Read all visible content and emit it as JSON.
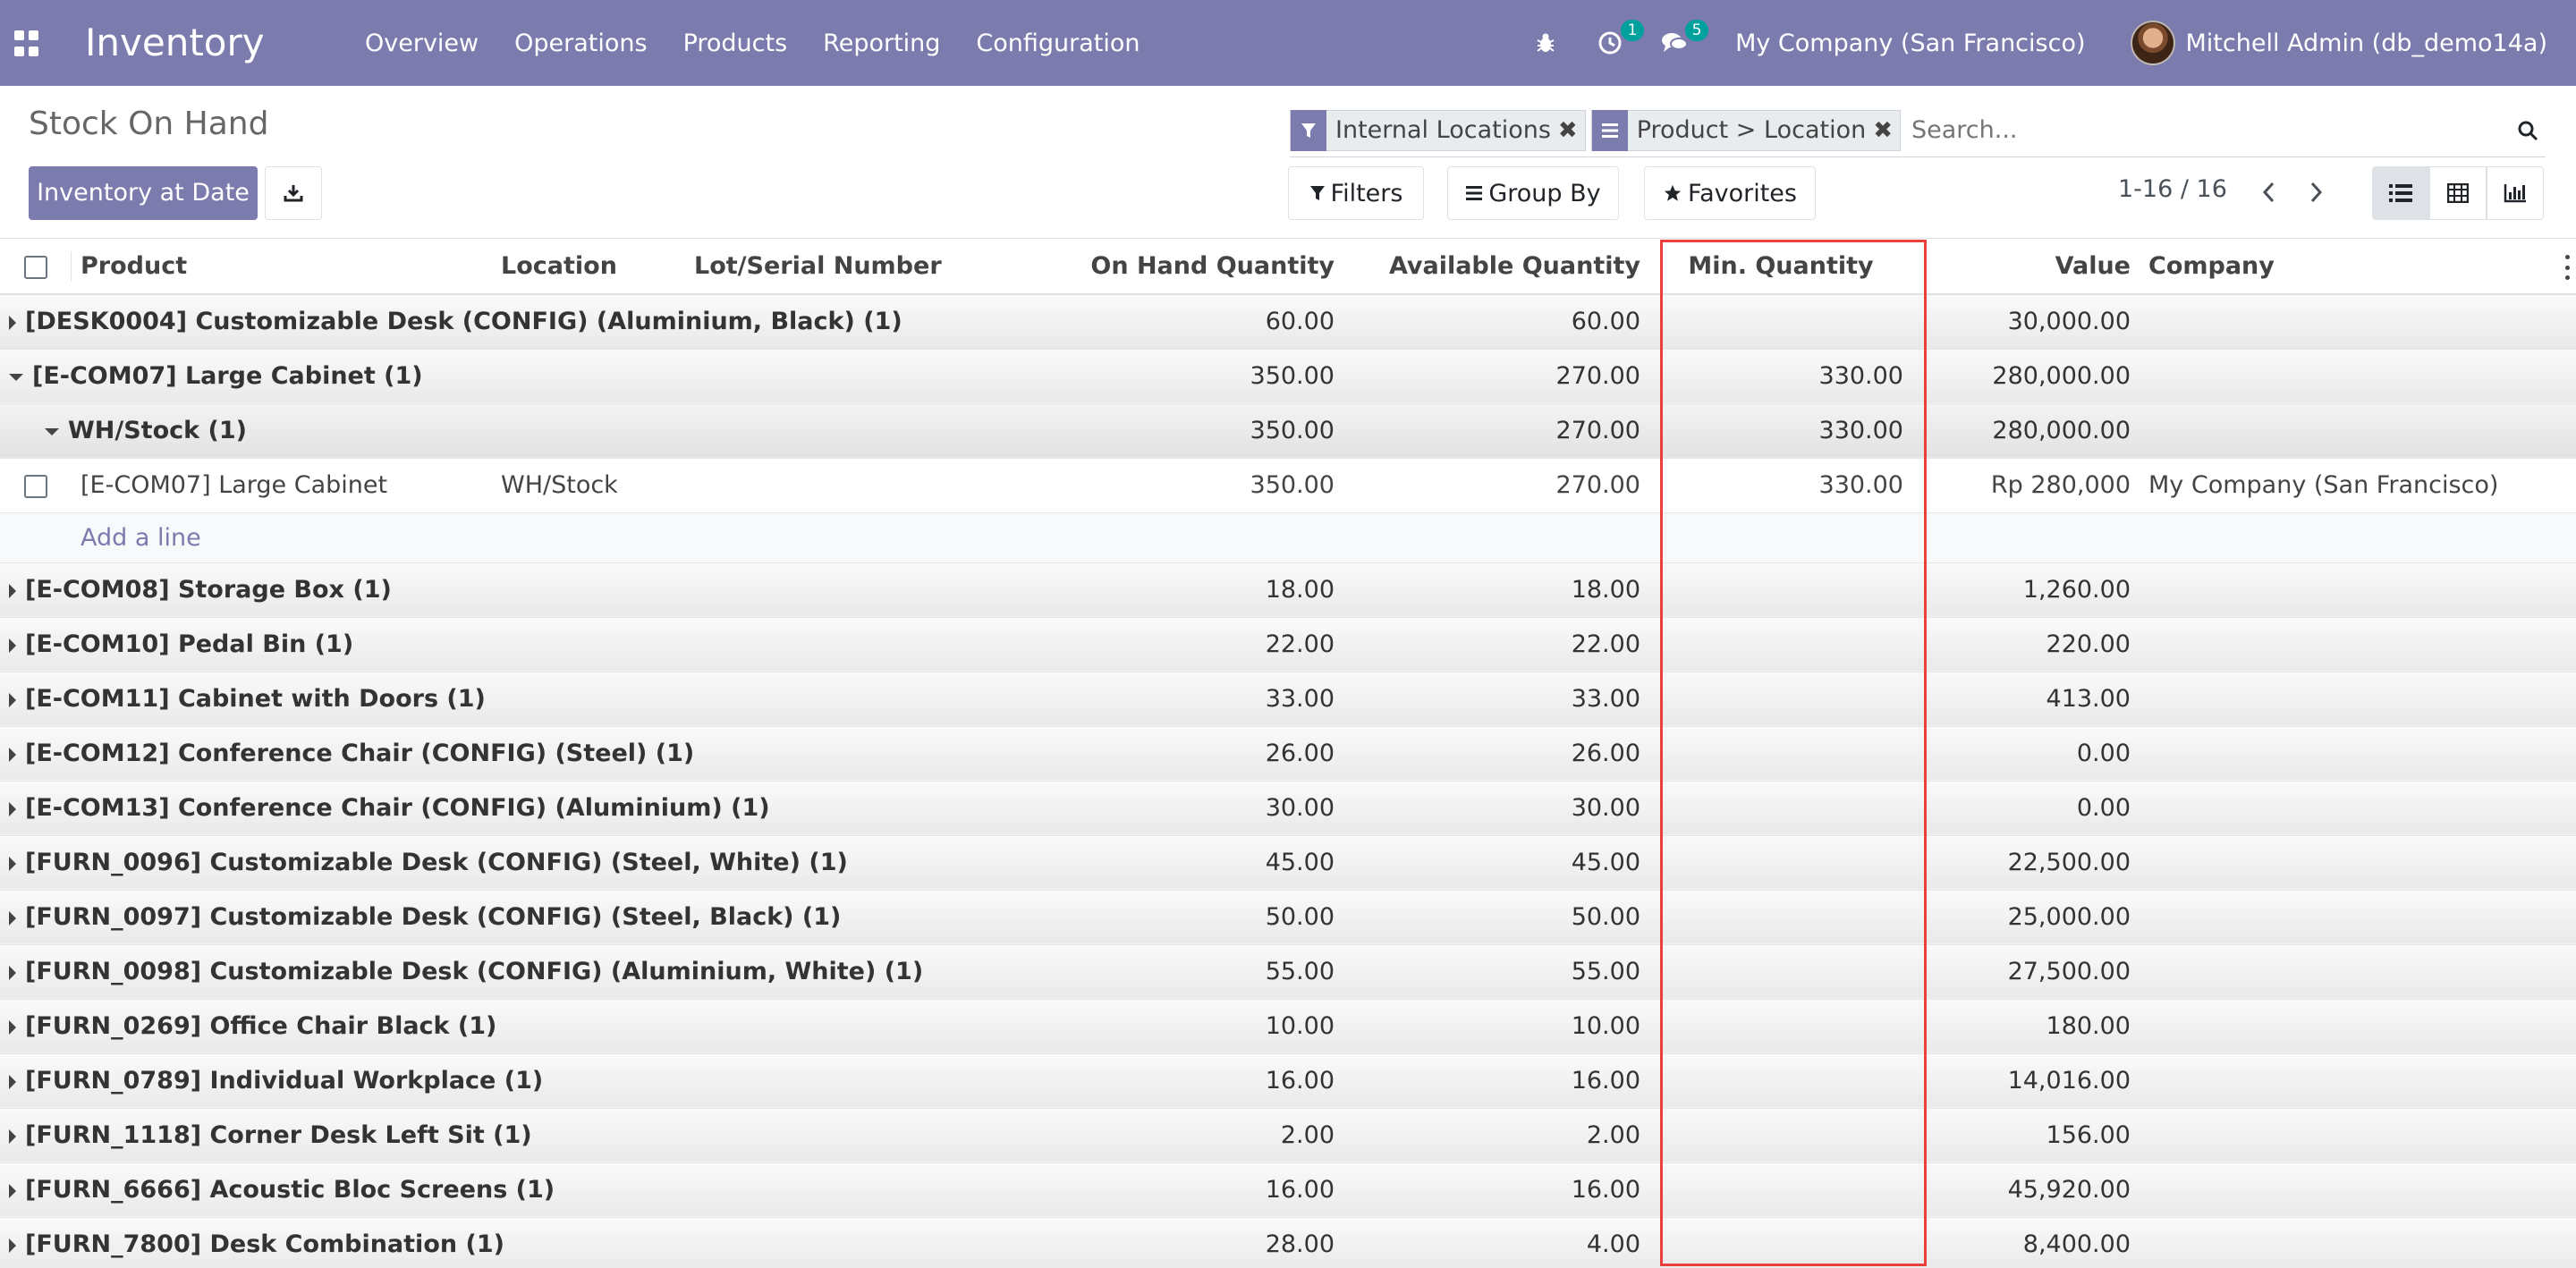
{
  "navbar": {
    "app_name": "Inventory",
    "menu": [
      "Overview",
      "Operations",
      "Products",
      "Reporting",
      "Configuration"
    ],
    "activity_count": "1",
    "messages_count": "5",
    "company": "My Company (San Francisco)",
    "user": "Mitchell Admin (db_demo14a)"
  },
  "control_panel": {
    "title": "Stock On Hand",
    "primary_button": "Inventory at Date",
    "facets": [
      {
        "icon": "filter-icon",
        "label": "Internal Locations"
      },
      {
        "icon": "group-icon",
        "label": "Product > Location"
      }
    ],
    "search_placeholder": "Search...",
    "filters_label": "Filters",
    "groupby_label": "Group By",
    "favorites_label": "Favorites",
    "pager": "1-16 / 16"
  },
  "table": {
    "columns": [
      "Product",
      "Location",
      "Lot/Serial Number",
      "On Hand Quantity",
      "Available Quantity",
      "Min. Quantity",
      "Value",
      "Company"
    ],
    "add_line_label": "Add a line",
    "rows": [
      {
        "kind": "group",
        "label": "[DESK0004] Customizable Desk (CONFIG) (Aluminium, Black) (1)",
        "expanded": false,
        "on_hand": "60.00",
        "available": "60.00",
        "min_qty": "",
        "value": "30,000.00",
        "location": "",
        "company": ""
      },
      {
        "kind": "group",
        "label": "[E-COM07] Large Cabinet (1)",
        "expanded": true,
        "on_hand": "350.00",
        "available": "270.00",
        "min_qty": "330.00",
        "value": "280,000.00",
        "location": "",
        "company": ""
      },
      {
        "kind": "sub",
        "label": "WH/Stock (1)",
        "expanded": true,
        "on_hand": "350.00",
        "available": "270.00",
        "min_qty": "330.00",
        "value": "280,000.00",
        "location": "",
        "company": ""
      },
      {
        "kind": "record",
        "label": "[E-COM07] Large Cabinet",
        "location": "WH/Stock",
        "on_hand": "350.00",
        "available": "270.00",
        "min_qty": "330.00",
        "value": "Rp 280,000",
        "company": "My Company (San Francisco)"
      },
      {
        "kind": "add"
      },
      {
        "kind": "group",
        "label": "[E-COM08] Storage Box (1)",
        "expanded": false,
        "on_hand": "18.00",
        "available": "18.00",
        "min_qty": "",
        "value": "1,260.00",
        "location": "",
        "company": ""
      },
      {
        "kind": "group",
        "label": "[E-COM10] Pedal Bin (1)",
        "expanded": false,
        "on_hand": "22.00",
        "available": "22.00",
        "min_qty": "",
        "value": "220.00",
        "location": "",
        "company": ""
      },
      {
        "kind": "group",
        "label": "[E-COM11] Cabinet with Doors (1)",
        "expanded": false,
        "on_hand": "33.00",
        "available": "33.00",
        "min_qty": "",
        "value": "413.00",
        "location": "",
        "company": ""
      },
      {
        "kind": "group",
        "label": "[E-COM12] Conference Chair (CONFIG) (Steel) (1)",
        "expanded": false,
        "on_hand": "26.00",
        "available": "26.00",
        "min_qty": "",
        "value": "0.00",
        "location": "",
        "company": ""
      },
      {
        "kind": "group",
        "label": "[E-COM13] Conference Chair (CONFIG) (Aluminium) (1)",
        "expanded": false,
        "on_hand": "30.00",
        "available": "30.00",
        "min_qty": "",
        "value": "0.00",
        "location": "",
        "company": ""
      },
      {
        "kind": "group",
        "label": "[FURN_0096] Customizable Desk (CONFIG) (Steel, White) (1)",
        "expanded": false,
        "on_hand": "45.00",
        "available": "45.00",
        "min_qty": "",
        "value": "22,500.00",
        "location": "",
        "company": ""
      },
      {
        "kind": "group",
        "label": "[FURN_0097] Customizable Desk (CONFIG) (Steel, Black) (1)",
        "expanded": false,
        "on_hand": "50.00",
        "available": "50.00",
        "min_qty": "",
        "value": "25,000.00",
        "location": "",
        "company": ""
      },
      {
        "kind": "group",
        "label": "[FURN_0098] Customizable Desk (CONFIG) (Aluminium, White) (1)",
        "expanded": false,
        "on_hand": "55.00",
        "available": "55.00",
        "min_qty": "",
        "value": "27,500.00",
        "location": "",
        "company": ""
      },
      {
        "kind": "group",
        "label": "[FURN_0269] Office Chair Black (1)",
        "expanded": false,
        "on_hand": "10.00",
        "available": "10.00",
        "min_qty": "",
        "value": "180.00",
        "location": "",
        "company": ""
      },
      {
        "kind": "group",
        "label": "[FURN_0789] Individual Workplace (1)",
        "expanded": false,
        "on_hand": "16.00",
        "available": "16.00",
        "min_qty": "",
        "value": "14,016.00",
        "location": "",
        "company": ""
      },
      {
        "kind": "group",
        "label": "[FURN_1118] Corner Desk Left Sit (1)",
        "expanded": false,
        "on_hand": "2.00",
        "available": "2.00",
        "min_qty": "",
        "value": "156.00",
        "location": "",
        "company": ""
      },
      {
        "kind": "group",
        "label": "[FURN_6666] Acoustic Bloc Screens (1)",
        "expanded": false,
        "on_hand": "16.00",
        "available": "16.00",
        "min_qty": "",
        "value": "45,920.00",
        "location": "",
        "company": ""
      },
      {
        "kind": "group",
        "label": "[FURN_7800] Desk Combination (1)",
        "expanded": false,
        "on_hand": "28.00",
        "available": "4.00",
        "min_qty": "",
        "value": "8,400.00",
        "location": "",
        "company": ""
      }
    ]
  },
  "colors": {
    "brand": "#7c7bad",
    "badge": "#00a09d",
    "highlight": "#e8403a"
  }
}
